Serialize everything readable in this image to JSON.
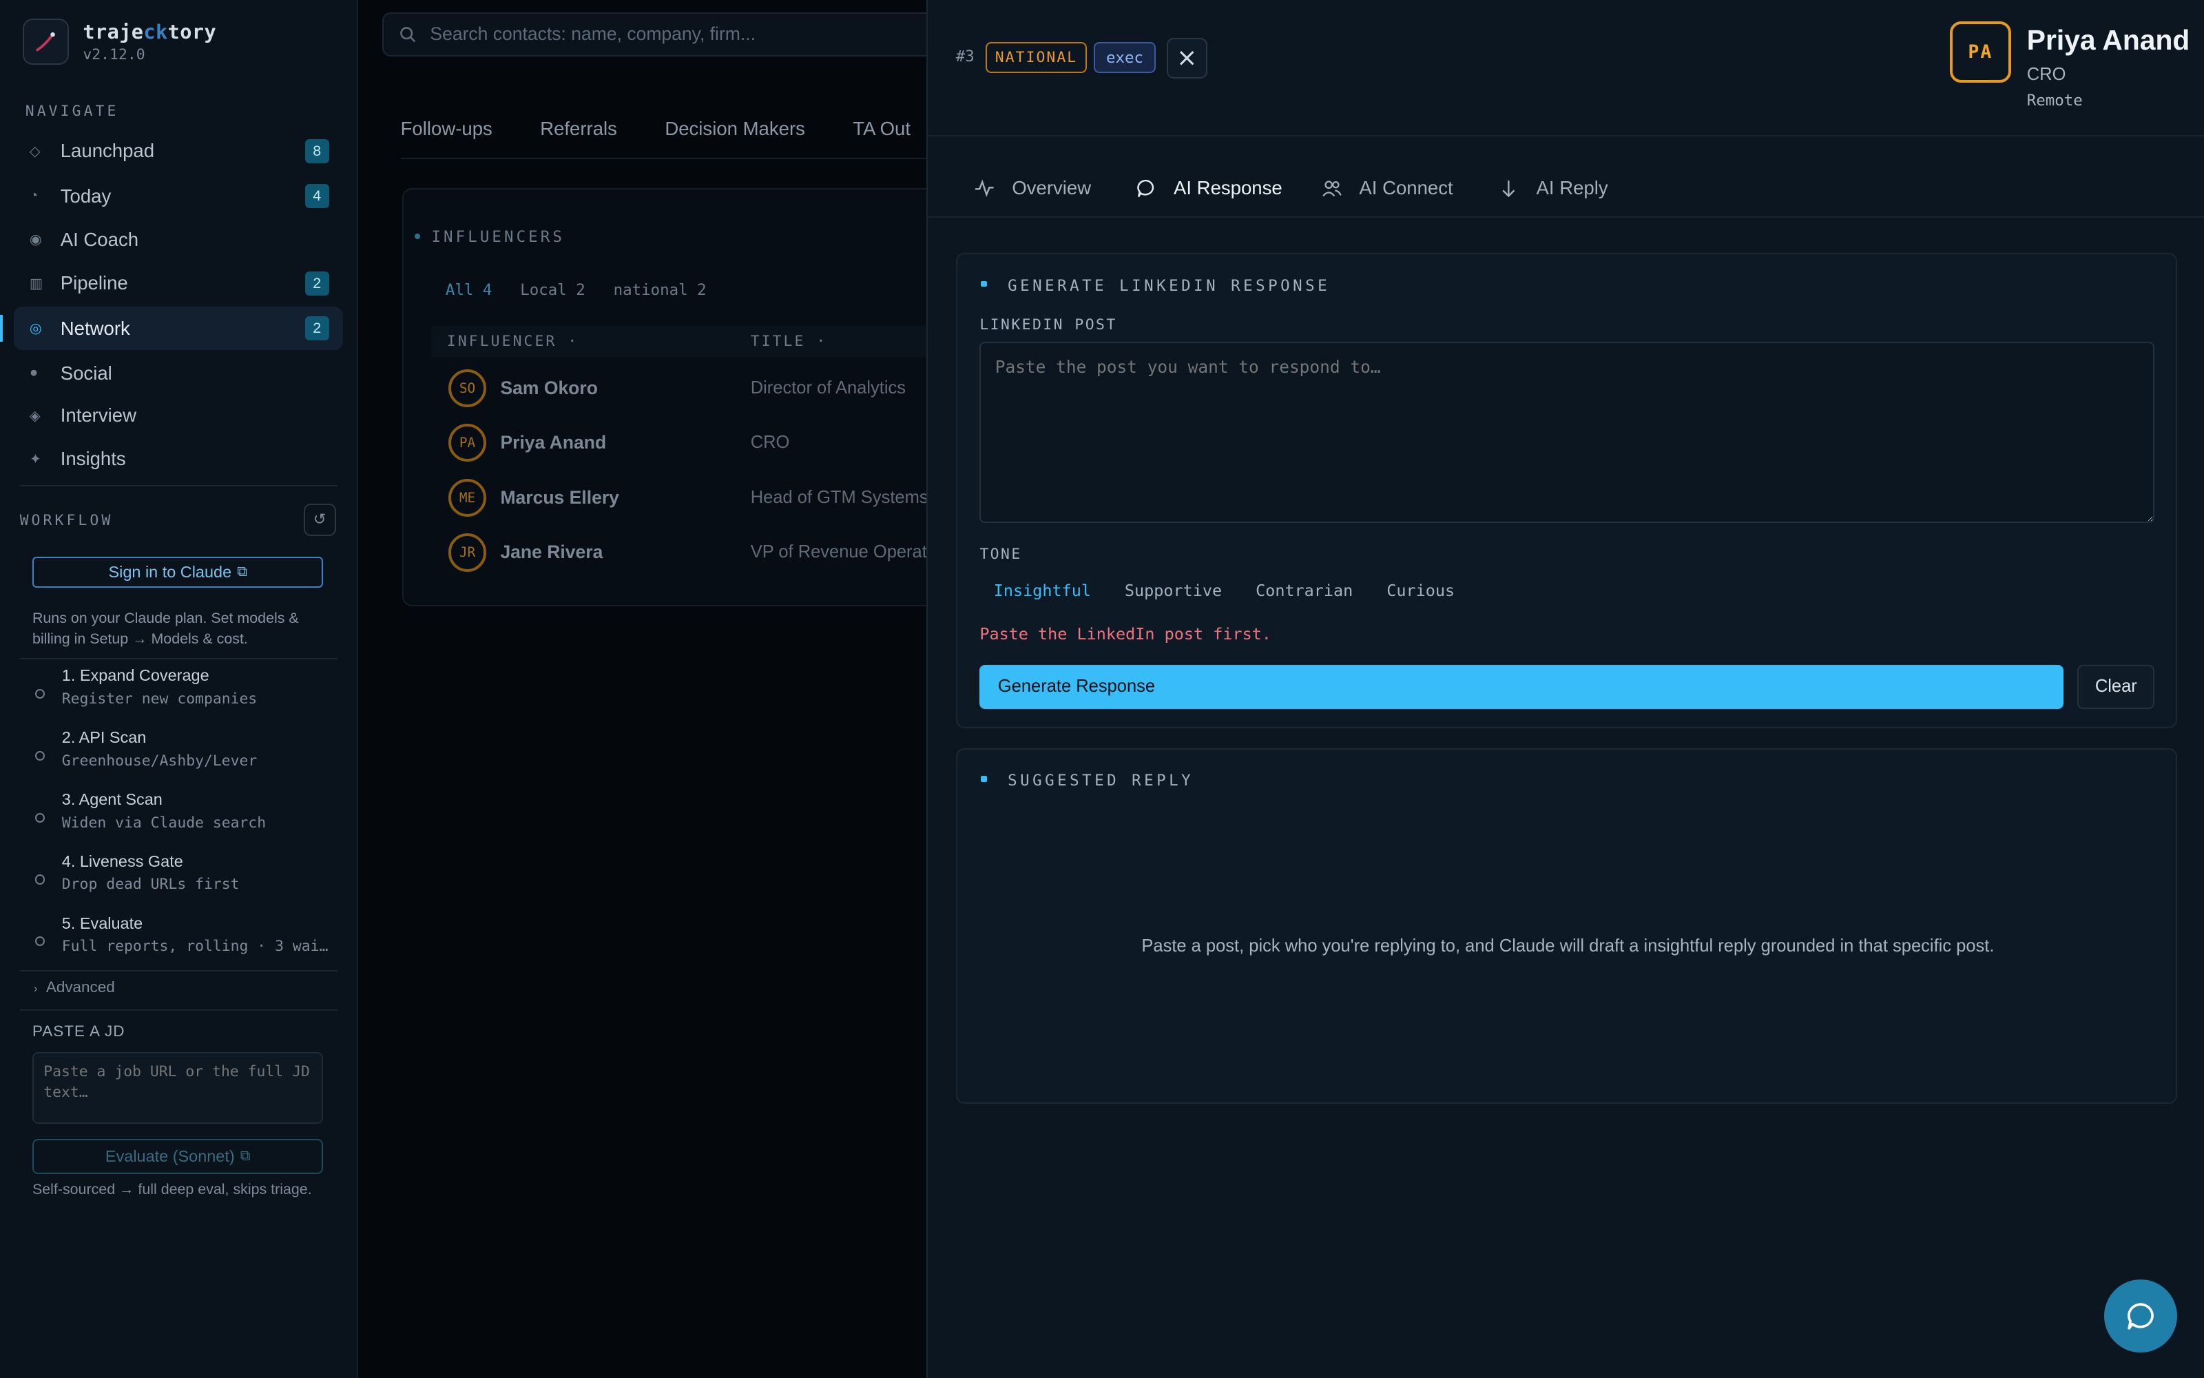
{
  "app": {
    "name_part1": "traje",
    "name_accent": "ck",
    "name_part2": "tory",
    "version": "v2.12.0"
  },
  "sidebar": {
    "navigate_label": "NAVIGATE",
    "items": [
      {
        "label": "Launchpad",
        "icon": "diamond-outline-icon",
        "badge": "8"
      },
      {
        "label": "Today",
        "icon": "clock-icon",
        "badge": "4"
      },
      {
        "label": "AI Coach",
        "icon": "dot-circle-icon",
        "badge": ""
      },
      {
        "label": "Pipeline",
        "icon": "columns-icon",
        "badge": "2"
      },
      {
        "label": "Network",
        "icon": "network-icon",
        "badge": "2"
      },
      {
        "label": "Social",
        "icon": "circle-icon",
        "badge": ""
      },
      {
        "label": "Interview",
        "icon": "diamond-icon",
        "badge": ""
      },
      {
        "label": "Insights",
        "icon": "sparkle-icon",
        "badge": ""
      }
    ],
    "active_item": "Network",
    "workflow_label": "WORKFLOW",
    "signin_label": "Sign in to Claude",
    "note": "Runs on your Claude plan. Set models & billing in Setup → Models & cost.",
    "steps": [
      {
        "title": "1. Expand Coverage",
        "sub": "Register new companies"
      },
      {
        "title": "2. API Scan",
        "sub": "Greenhouse/Ashby/Lever"
      },
      {
        "title": "3. Agent Scan",
        "sub": "Widen via Claude search"
      },
      {
        "title": "4. Liveness Gate",
        "sub": "Drop dead URLs first"
      },
      {
        "title": "5. Evaluate",
        "sub": "Full reports, rolling · 3 wai…"
      }
    ],
    "advanced_label": "Advanced",
    "jd_label": "PASTE A JD",
    "jd_placeholder": "Paste a job URL or the full JD text…",
    "evaluate_label": "Evaluate (Sonnet)",
    "evaluate_note": "Self-sourced → full deep eval, skips triage."
  },
  "main": {
    "search_placeholder": "Search contacts: name, company, firm...",
    "tabs": [
      "Follow-ups",
      "Referrals",
      "Decision Makers",
      "TA Out"
    ],
    "card_title": "INFLUENCERS",
    "filters": [
      "All 4",
      "Local 2",
      "national 2"
    ],
    "columns": [
      "INFLUENCER",
      "TITLE"
    ],
    "rows": [
      {
        "initials": "SO",
        "name": "Sam Okoro",
        "title": "Director of Analytics"
      },
      {
        "initials": "PA",
        "name": "Priya Anand",
        "title": "CRO"
      },
      {
        "initials": "ME",
        "name": "Marcus Ellery",
        "title": "Head of GTM Systems"
      },
      {
        "initials": "JR",
        "name": "Jane Rivera",
        "title": "VP of Revenue Operati"
      }
    ]
  },
  "drawer": {
    "id_tag": "#3",
    "scope_tag": "NATIONAL",
    "level_tag": "exec",
    "contact": {
      "initials": "PA",
      "name": "Priya Anand",
      "role": "CRO",
      "location": "Remote"
    },
    "tabs": [
      {
        "label": "Overview",
        "icon": "activity-icon"
      },
      {
        "label": "AI Response",
        "icon": "message-icon"
      },
      {
        "label": "AI Connect",
        "icon": "users-icon"
      },
      {
        "label": "AI Reply",
        "icon": "arrow-down-icon"
      }
    ],
    "active_tab": "AI Response",
    "generate_panel": {
      "title": "GENERATE LINKEDIN RESPONSE",
      "post_label": "LINKEDIN POST",
      "post_placeholder": "Paste the post you want to respond to…",
      "tone_label": "TONE",
      "tones": [
        "Insightful",
        "Supportive",
        "Contrarian",
        "Curious"
      ],
      "selected_tone": "Insightful",
      "error": "Paste the LinkedIn post first.",
      "generate_label": "Generate Response",
      "clear_label": "Clear"
    },
    "reply_panel": {
      "title": "SUGGESTED REPLY",
      "empty_message": "Paste a post, pick who you're replying to, and Claude will draft a insightful reply grounded in that specific post."
    }
  },
  "colors": {
    "accent": "#38bdf8",
    "warning": "#e89a1a",
    "error": "#f1727a",
    "background": "#0b1620"
  }
}
